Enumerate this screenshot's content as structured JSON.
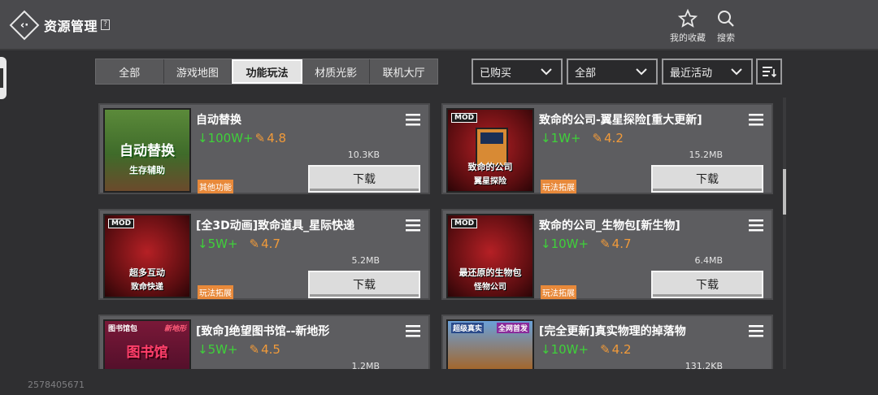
{
  "header": {
    "title": "资源管理",
    "help_glyph": "?",
    "favorites_label": "我的收藏",
    "search_label": "搜索"
  },
  "tabs": [
    {
      "label": "全部",
      "active": false
    },
    {
      "label": "游戏地图",
      "active": false
    },
    {
      "label": "功能玩法",
      "active": true
    },
    {
      "label": "材质光影",
      "active": false
    },
    {
      "label": "联机大厅",
      "active": false
    }
  ],
  "filters": {
    "purchased": "已购买",
    "scope": "全部",
    "sort": "最近活动"
  },
  "download_label": "下载",
  "items": [
    {
      "title": "自动替换",
      "downloads": "100W+",
      "rating": "4.8",
      "size": "10.3KB",
      "category": "其他功能",
      "thumb_text": "自动替换",
      "thumb_sub": "生存辅助"
    },
    {
      "title": "致命的公司-翼星探险[重大更新]",
      "downloads": "1W+",
      "rating": "4.2",
      "size": "15.2MB",
      "category": "玩法拓展",
      "thumb_tag": "MOD",
      "thumb_caption": "翼星探险",
      "thumb_caption2": "致命的公司"
    },
    {
      "title": "[全3D动画]致命道具_星际快递",
      "downloads": "5W+",
      "rating": "4.7",
      "size": "5.2MB",
      "category": "玩法拓展",
      "thumb_tag": "MOD",
      "thumb_caption": "致命快递",
      "thumb_caption2": "超多互动"
    },
    {
      "title": "致命的公司_生物包[新生物]",
      "downloads": "10W+",
      "rating": "4.7",
      "size": "6.4MB",
      "category": "玩法拓展",
      "thumb_tag": "MOD",
      "thumb_caption": "怪物公司",
      "thumb_caption2": "最还原的生物包"
    },
    {
      "title": "[致命]绝望图书馆--新地形",
      "downloads": "5W+",
      "rating": "4.5",
      "size": "1.2MB",
      "category": "",
      "thumb_tag": "图书馆包",
      "thumb_tag2": "新地形",
      "thumb_caption2": "图书馆"
    },
    {
      "title": "[完全更新]真实物理的掉落物",
      "downloads": "10W+",
      "rating": "4.2",
      "size": "131.2KB",
      "category": "",
      "thumb_tag": "超级真实",
      "thumb_tag2": "全网首发"
    }
  ],
  "footer": {
    "user_id": "2578405671"
  },
  "colors": {
    "download_green": "#3fd13a",
    "rating_orange": "#f09a3a",
    "category_badge": "#e8893a"
  }
}
